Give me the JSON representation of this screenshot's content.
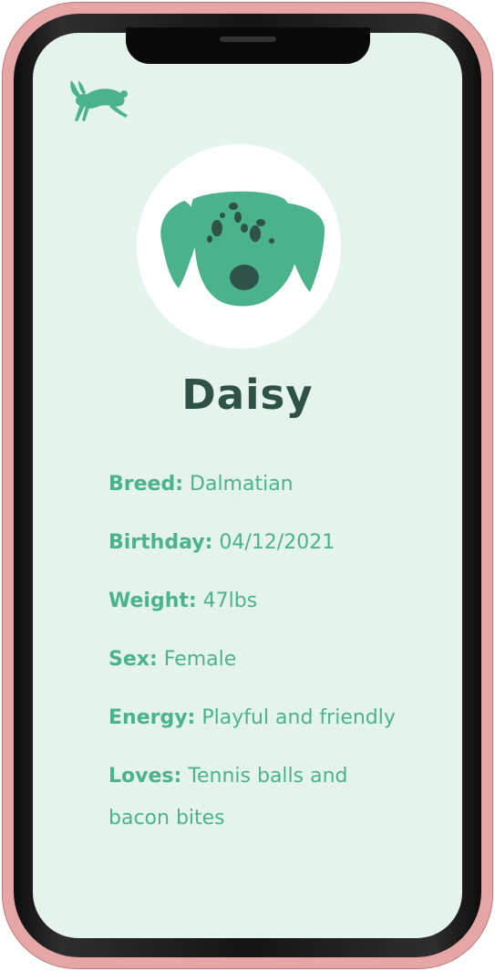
{
  "app": {
    "logo_icon": "rabbit-icon",
    "accent_color": "#4bb38c",
    "name_color": "#2e5247",
    "background_color": "#e4f3ec"
  },
  "profile": {
    "avatar_icon": "dalmatian-head-icon",
    "name": "Daisy",
    "details": [
      {
        "key": "Breed:",
        "value": "Dalmatian"
      },
      {
        "key": "Birthday:",
        "value": "04/12/2021"
      },
      {
        "key": "Weight:",
        "value": "47lbs"
      },
      {
        "key": "Sex:",
        "value": "Female"
      },
      {
        "key": "Energy:",
        "value": "Playful and friendly"
      },
      {
        "key": "Loves:",
        "value": "Tennis balls and bacon bites"
      }
    ]
  }
}
